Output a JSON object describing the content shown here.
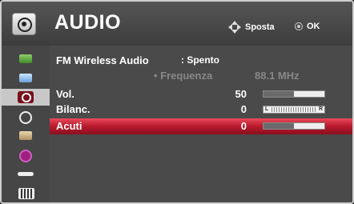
{
  "header": {
    "title": "AUDIO",
    "move_label": "Sposta",
    "ok_label": "OK",
    "title_icon": "audio-icon"
  },
  "sidebar": {
    "items": [
      {
        "icon": "picture-icon"
      },
      {
        "icon": "screen-icon"
      },
      {
        "icon": "audio-icon",
        "active": true
      },
      {
        "icon": "time-icon"
      },
      {
        "icon": "setup-icon"
      },
      {
        "icon": "info-icon"
      },
      {
        "icon": "input-icon"
      },
      {
        "icon": "media-icon"
      }
    ]
  },
  "menu": {
    "fm": {
      "label": "FM Wireless Audio",
      "value": ": Spento"
    },
    "frequency": {
      "label": "• Frequenza",
      "value": "88.1 MHz"
    },
    "volume": {
      "label": "Vol.",
      "value": "50",
      "level_percent": 50
    },
    "balance": {
      "label": "Bilanc.",
      "value": "0",
      "left": "L",
      "right": "R"
    },
    "treble": {
      "label": "Acuti",
      "value": "0",
      "level_percent": 50
    }
  },
  "colors": {
    "selection": "#c8283a",
    "background": "#4a4a4a"
  }
}
